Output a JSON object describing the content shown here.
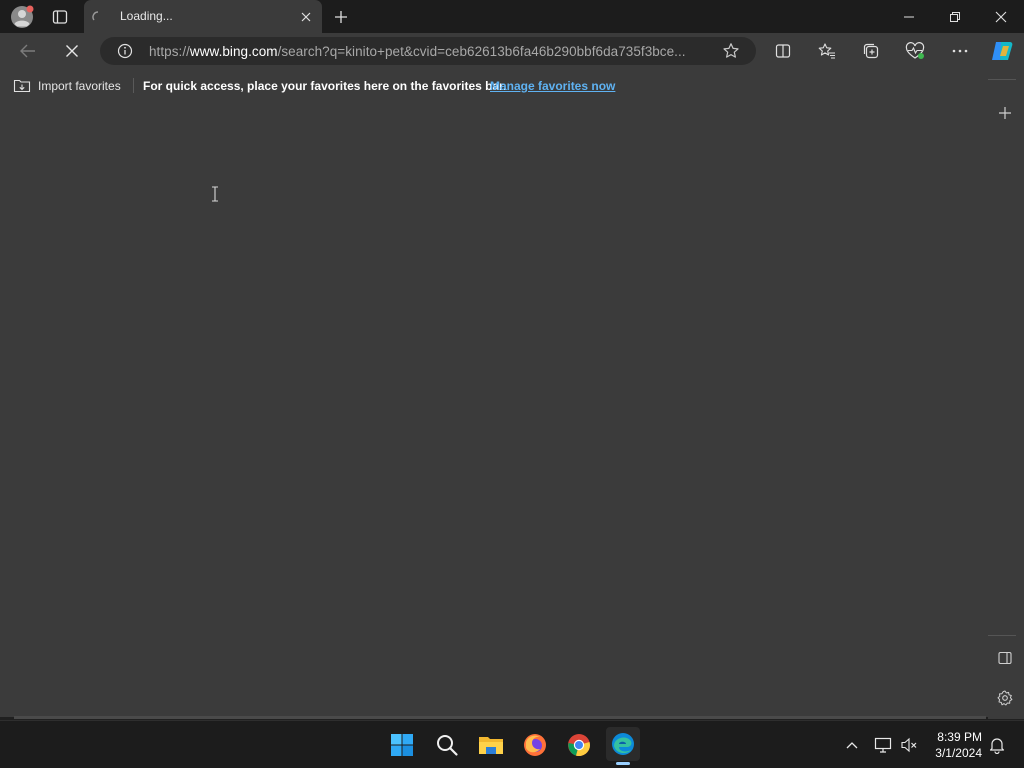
{
  "browser": {
    "tab": {
      "title": "Loading..."
    },
    "address": {
      "scheme": "https://",
      "domain": "www.bing.com",
      "path": "/search?q=kinito+pet&cvid=ceb62613b6fa46b290bbf6da735f3bce..."
    },
    "favorites_bar": {
      "import_label": "Import favorites",
      "message": "For quick access, place your favorites here on the favorites bar.",
      "manage_link": "Manage favorites now"
    }
  },
  "taskbar": {
    "time": "8:39 PM",
    "date": "3/1/2024",
    "apps": [
      "start-icon",
      "search-icon",
      "file-explorer-icon",
      "firefox-icon",
      "chrome-icon",
      "edge-icon"
    ]
  },
  "colors": {
    "page_background": "#3b3b3b",
    "titlebar": "#1c1c1c",
    "link": "#5fb2f2",
    "taskbar": "#1c1c1c"
  }
}
